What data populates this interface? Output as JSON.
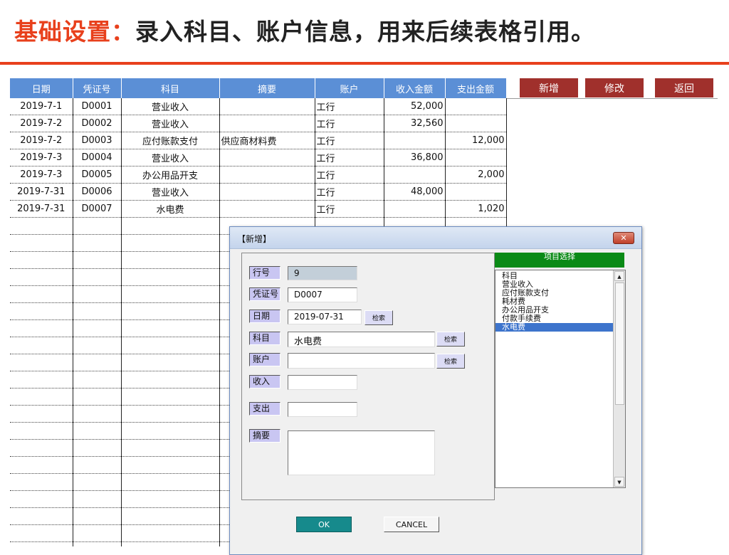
{
  "headline": {
    "accent": "基础设置：",
    "rest": "录入科目、账户信息，用来后续表格引用。"
  },
  "table": {
    "columns": [
      "日期",
      "凭证号",
      "科目",
      "摘要",
      "账户",
      "收入金额",
      "支出金额"
    ],
    "rows": [
      [
        "2019-7-1",
        "D0001",
        "营业收入",
        "",
        "工行",
        "52,000",
        ""
      ],
      [
        "2019-7-2",
        "D0002",
        "营业收入",
        "",
        "工行",
        "32,560",
        ""
      ],
      [
        "2019-7-2",
        "D0003",
        "应付账款支付",
        "供应商材料费",
        "工行",
        "",
        "12,000"
      ],
      [
        "2019-7-3",
        "D0004",
        "营业收入",
        "",
        "工行",
        "36,800",
        ""
      ],
      [
        "2019-7-3",
        "D0005",
        "办公用品开支",
        "",
        "工行",
        "",
        "2,000"
      ],
      [
        "2019-7-31",
        "D0006",
        "营业收入",
        "",
        "工行",
        "48,000",
        ""
      ],
      [
        "2019-7-31",
        "D0007",
        "水电费",
        "",
        "工行",
        "",
        "1,020"
      ]
    ]
  },
  "actions": {
    "add": "新增",
    "edit": "修改",
    "back": "返回"
  },
  "dialog": {
    "title": "【新增】",
    "close": "✕",
    "labels": {
      "row_no": "行号",
      "voucher": "凭证号",
      "date": "日期",
      "subject": "科目",
      "account": "账户",
      "income": "收入",
      "expense": "支出",
      "summary": "摘要"
    },
    "values": {
      "row_no": "9",
      "voucher": "D0007",
      "date": "2019-07-31",
      "subject": "水电费",
      "account": "",
      "income": "",
      "expense": "",
      "summary": ""
    },
    "search_label": "检索",
    "picker": {
      "header": "项目选择",
      "items": [
        "科目",
        "营业收入",
        "应付账款支付",
        "耗材费",
        "办公用品开支",
        "付款手续费",
        "水电费"
      ],
      "selected_index": 6
    },
    "ok": "OK",
    "cancel": "CANCEL"
  }
}
